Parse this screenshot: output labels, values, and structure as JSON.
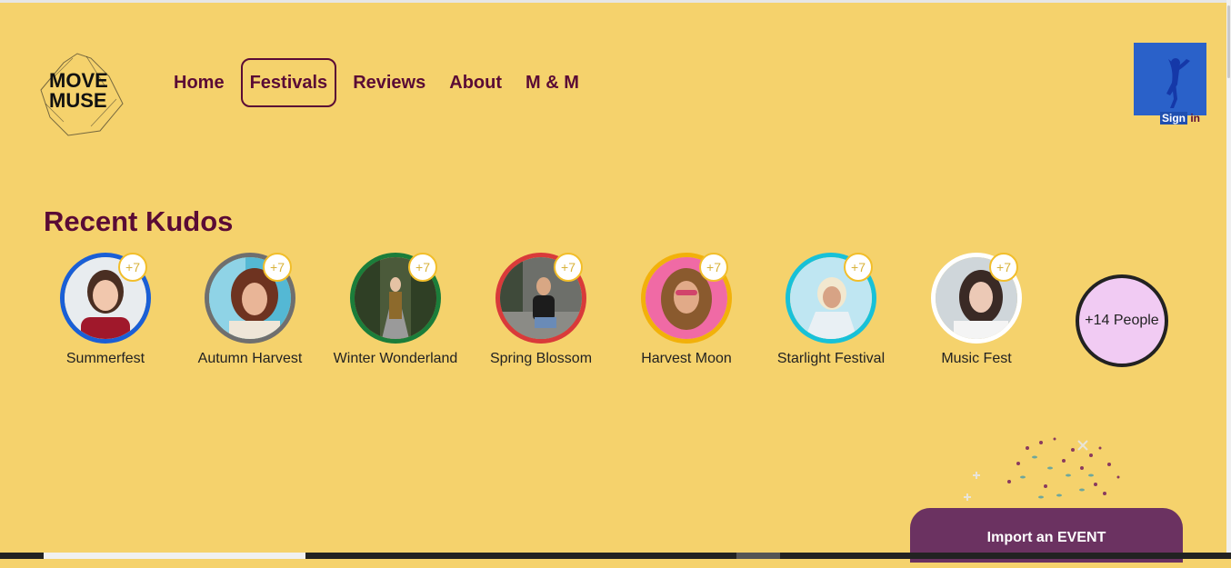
{
  "header": {
    "logo_text_line1": "MOVE",
    "logo_text_line2": "MUSE",
    "nav": [
      {
        "label": "Home",
        "active": false
      },
      {
        "label": "Festivals",
        "active": true
      },
      {
        "label": "Reviews",
        "active": false
      },
      {
        "label": "About",
        "active": false
      },
      {
        "label": "M & M",
        "active": false
      }
    ],
    "signin": {
      "label_highlight": "Sign",
      "label_rest": "in"
    }
  },
  "kudos": {
    "title": "Recent Kudos",
    "items": [
      {
        "label": "Summerfest",
        "badge": "+7",
        "ring": "#1a5fd6"
      },
      {
        "label": "Autumn Harvest",
        "badge": "+7",
        "ring": "#6f6f6f"
      },
      {
        "label": "Winter Wonderland",
        "badge": "+7",
        "ring": "#1b7d3a"
      },
      {
        "label": "Spring Blossom",
        "badge": "+7",
        "ring": "#d93a3a"
      },
      {
        "label": "Harvest Moon",
        "badge": "+7",
        "ring": "#f2b10a"
      },
      {
        "label": "Starlight Festival",
        "badge": "+7",
        "ring": "#18c1d8"
      },
      {
        "label": "Music Fest",
        "badge": "+7",
        "ring": "#ffffff"
      }
    ],
    "more": "+14 People"
  },
  "cta": {
    "label": "Import an EVENT"
  },
  "colors": {
    "background": "#f5d26c",
    "accent": "#5a0b35",
    "cta": "#6b3261",
    "signin": "#2a61c9"
  }
}
